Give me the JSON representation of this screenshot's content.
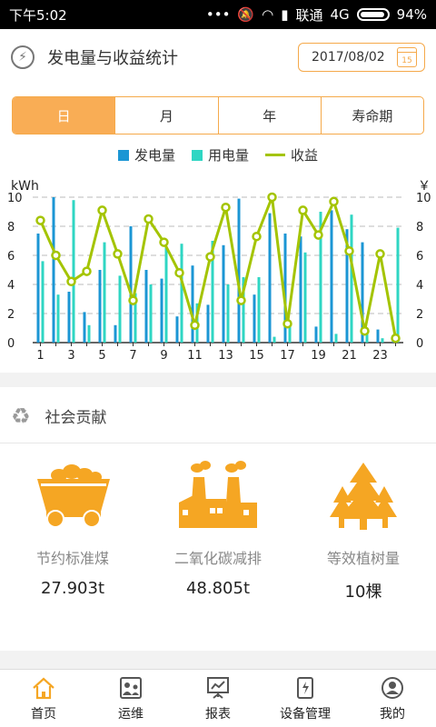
{
  "status_bar": {
    "time": "下午5:02",
    "icons": [
      "more-dots-icon",
      "mute-icon",
      "wifi-icon",
      "signal-icon",
      "battery-icon"
    ],
    "carrier": "联通",
    "network": "4G",
    "battery": "94%"
  },
  "header": {
    "icon": "lightning-bolt-icon",
    "title": "发电量与收益统计",
    "date": "2017/08/02",
    "calendar_day": "15"
  },
  "tabs": [
    {
      "label": "日",
      "active": true
    },
    {
      "label": "月",
      "active": false
    },
    {
      "label": "年",
      "active": false
    },
    {
      "label": "寿命期",
      "active": false
    }
  ],
  "colors": {
    "accent": "#f9ad55",
    "generation": "#1b96d4",
    "consumption": "#2fd6c3",
    "income": "#a4c400",
    "icon_orange": "#f5a623"
  },
  "chart_data": {
    "type": "bar",
    "legend": [
      "发电量",
      "用电量",
      "收益"
    ],
    "left_unit": "kWh",
    "right_unit": "￥",
    "y_ticks": [
      "0",
      "2",
      "4",
      "6",
      "8",
      "10"
    ],
    "ylim": [
      0,
      10
    ],
    "grid": true,
    "x": [
      1,
      2,
      3,
      4,
      5,
      6,
      7,
      8,
      9,
      10,
      11,
      12,
      13,
      14,
      15,
      16,
      17,
      18,
      19,
      20,
      21,
      22,
      23,
      24
    ],
    "x_tick_labels": [
      "1",
      "3",
      "5",
      "7",
      "9",
      "11",
      "13",
      "15",
      "17",
      "19",
      "21",
      "23"
    ],
    "series": [
      {
        "name": "发电量",
        "kind": "bar",
        "values": [
          7.5,
          10.0,
          3.5,
          2.1,
          5.0,
          1.2,
          8.0,
          5.0,
          4.4,
          1.8,
          5.3,
          2.6,
          6.7,
          9.9,
          3.3,
          8.9,
          7.5,
          7.3,
          1.1,
          9.1,
          7.8,
          6.9,
          0.9,
          0.1
        ]
      },
      {
        "name": "用电量",
        "kind": "bar",
        "values": [
          5.6,
          3.3,
          9.8,
          1.2,
          6.9,
          4.6,
          3.4,
          4.0,
          6.6,
          6.8,
          2.7,
          7.0,
          4.0,
          4.5,
          4.5,
          0.4,
          1.4,
          6.2,
          9.0,
          0.6,
          8.8,
          0.8,
          0.3,
          7.9
        ]
      },
      {
        "name": "收益",
        "kind": "line",
        "values": [
          8.4,
          6.0,
          4.2,
          4.9,
          9.1,
          6.1,
          2.9,
          8.5,
          6.9,
          4.8,
          1.2,
          5.9,
          9.3,
          2.9,
          7.3,
          10.0,
          1.3,
          9.1,
          7.4,
          9.7,
          6.3,
          0.8,
          6.1,
          0.3
        ]
      }
    ]
  },
  "social": {
    "icon": "recycle-icon",
    "title": "社会贡献",
    "items": [
      {
        "icon": "coal-cart-icon",
        "label": "节约标准煤",
        "value": "27.903t"
      },
      {
        "icon": "factory-icon",
        "label": "二氧化碳减排",
        "value": "48.805t"
      },
      {
        "icon": "tree-icon",
        "label": "等效植树量",
        "value": "10棵"
      }
    ]
  },
  "tabbar": [
    {
      "label": "首页",
      "icon": "home-icon",
      "active": true
    },
    {
      "label": "运维",
      "icon": "maintenance-icon",
      "active": false
    },
    {
      "label": "报表",
      "icon": "report-icon",
      "active": false
    },
    {
      "label": "设备管理",
      "icon": "device-icon",
      "active": false
    },
    {
      "label": "我的",
      "icon": "profile-icon",
      "active": false
    }
  ]
}
